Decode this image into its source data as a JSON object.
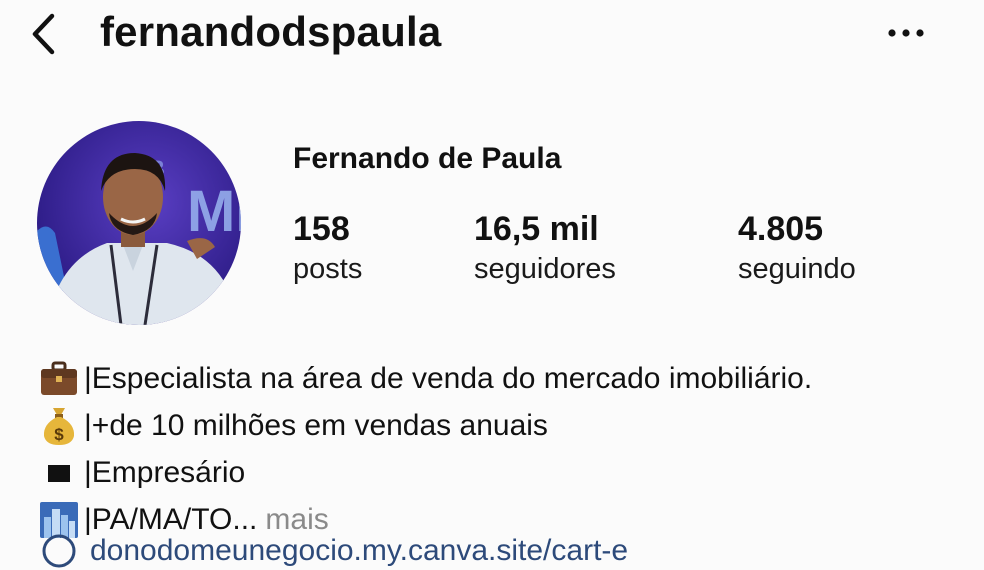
{
  "header": {
    "username": "fernandodspaula",
    "back_icon": "chevron-left-icon",
    "more_icon": "more-horizontal-icon"
  },
  "profile": {
    "display_name": "Fernando de Paula",
    "avatar_icon": "profile-avatar",
    "stats": [
      {
        "value": "158",
        "label": "posts"
      },
      {
        "value": "16,5 mil",
        "label": "seguidores"
      },
      {
        "value": "4.805",
        "label": "seguindo"
      }
    ]
  },
  "bio": {
    "lines": [
      {
        "icon": "briefcase-icon",
        "text": "|Especialista na área de venda do mercado imobiliário."
      },
      {
        "icon": "money-bag-icon",
        "text": "|+de 10 milhões em vendas anuais"
      },
      {
        "icon": "black-square-icon",
        "text": "|Empresário"
      },
      {
        "icon": "cityscape-icon",
        "text": "|PA/MA/TO..."
      }
    ],
    "more_label": "mais",
    "link_icon": "link-icon",
    "link_text": "donodomeunegocio.my.canva.site/cart-e"
  }
}
